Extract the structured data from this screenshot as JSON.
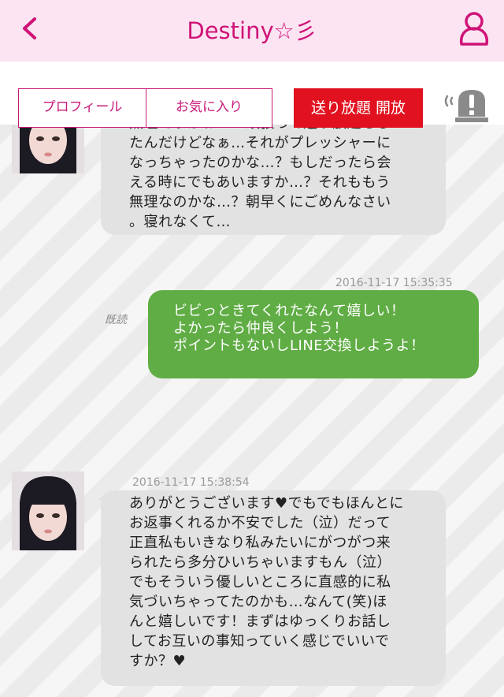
{
  "header": {
    "title": "Destiny☆彡",
    "back_icon": "chevron-left-icon",
    "profile_icon": "user-icon",
    "accent_color": "#cf1377",
    "background_color": "#fce4f2"
  },
  "toolbar": {
    "profile_label": "プロフィール",
    "favorite_label": "お気に入り",
    "unlimited_label": "送り放題 開放",
    "report_icon": "alert-icon"
  },
  "messages": [
    {
      "side": "left",
      "lines": [
        "無理でうかね…？頑張って送り放題もし",
        "たんだけどなぁ…それがプレッシャーに",
        "なっちゃったのかな…？もしだったら会",
        "える時にでもあいますか…？それももう",
        "無理なのかな…？朝早くにごめんなさい",
        "。寝れなくて…"
      ]
    },
    {
      "side": "right",
      "timestamp": "2016-11-17 15:35:35",
      "read_label": "既読",
      "lines": [
        "ビビっときてくれたなんて嬉しい！",
        "よかったら仲良くしよう！",
        "ポイントもないしLINE交換しようよ！"
      ]
    },
    {
      "side": "left",
      "timestamp": "2016-11-17 15:38:54",
      "lines": [
        "ありがとうございます♥でもでもほんとに",
        "お返事くれるか不安でした（泣）だって",
        "正直私もいきなり私みたいにがつがつ来",
        "られたら多分ひいちゃいますもん（泣）",
        "でもそういう優しいところに直感的に私",
        "気づいちゃってたのかも…なんて(笑)ほ",
        "んと嬉しいです！まずはゆっくりお話し",
        "してお互いの事知っていく感じでいいで",
        "すか？♥"
      ]
    }
  ]
}
